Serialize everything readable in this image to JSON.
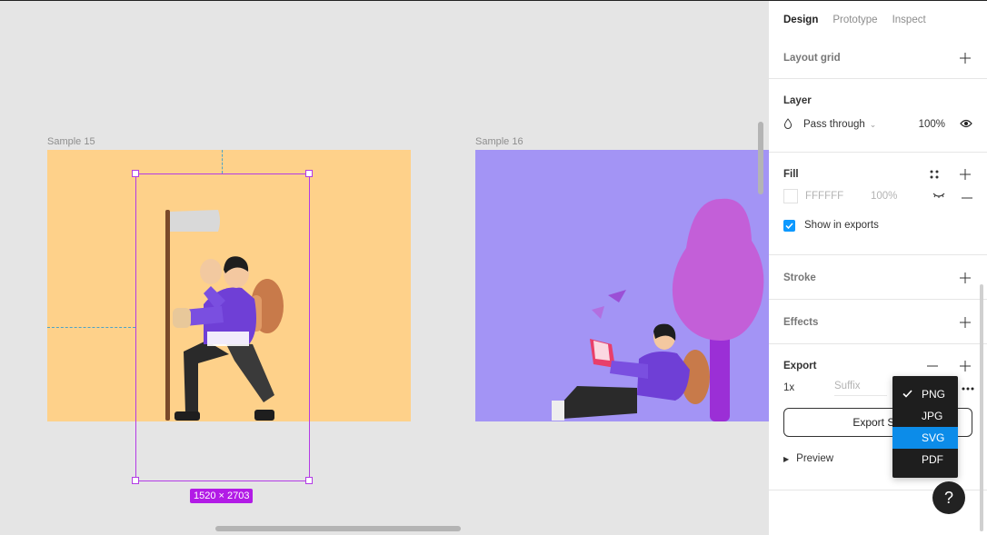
{
  "canvas": {
    "frame15_label": "Sample 15",
    "frame16_label": "Sample 16",
    "selection_size": "1520 × 2703"
  },
  "panel": {
    "tabs": [
      "Design",
      "Prototype",
      "Inspect"
    ],
    "layout_grid": {
      "title": "Layout grid"
    },
    "layer": {
      "title": "Layer",
      "blend_mode": "Pass through",
      "opacity": "100%"
    },
    "fill": {
      "title": "Fill",
      "hex": "FFFFFF",
      "opacity": "100%",
      "show_in_exports": "Show in exports"
    },
    "stroke": {
      "title": "Stroke"
    },
    "effects": {
      "title": "Effects"
    },
    "export": {
      "title": "Export",
      "scale": "1x",
      "suffix_placeholder": "Suffix",
      "button_label": "Export Sal",
      "preview": "Preview"
    }
  },
  "format_dropdown": {
    "options": [
      "PNG",
      "JPG",
      "SVG",
      "PDF"
    ],
    "checked": "PNG",
    "highlighted": "SVG"
  },
  "help": {
    "label": "?"
  },
  "colors": {
    "accent_blue": "#0d99ff",
    "selection_purple": "#b33be6",
    "frame15_bg": "#fed18a",
    "frame16_bg": "#a394f5"
  }
}
